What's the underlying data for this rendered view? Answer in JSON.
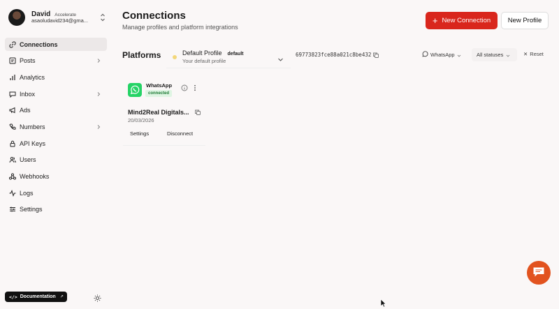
{
  "account": {
    "name": "David",
    "plan": "Accelerate",
    "email": "asaoludavid234@gma..."
  },
  "nav": {
    "items": [
      {
        "label": "Connections",
        "icon": "link-icon",
        "active": true
      },
      {
        "label": "Posts",
        "icon": "post-icon",
        "chevron": true
      },
      {
        "label": "Analytics",
        "icon": "bar-chart-icon"
      },
      {
        "label": "Inbox",
        "icon": "message-icon",
        "chevron": true
      },
      {
        "label": "Ads",
        "icon": "megaphone-icon"
      },
      {
        "label": "Numbers",
        "icon": "phone-icon",
        "chevron": true
      },
      {
        "label": "API Keys",
        "icon": "lock-icon"
      },
      {
        "label": "Users",
        "icon": "users-icon"
      },
      {
        "label": "Webhooks",
        "icon": "webhook-icon"
      },
      {
        "label": "Logs",
        "icon": "activity-icon"
      },
      {
        "label": "Settings",
        "icon": "sliders-icon"
      }
    ]
  },
  "footer": {
    "documentation_label": "Documentation"
  },
  "header": {
    "title": "Connections",
    "subtitle": "Manage profiles and platform integrations",
    "new_connection_label": "New Connection",
    "new_profile_label": "New Profile"
  },
  "platforms": {
    "title": "Platforms",
    "profile": {
      "name": "Default Profile",
      "tag": "default",
      "description": "Your default profile"
    },
    "profile_id": "69773823fce88a021c8be432",
    "filters": {
      "platform": "WhatsApp",
      "status": "All statuses",
      "reset_label": "Reset"
    }
  },
  "cards": [
    {
      "platform": "WhatsApp",
      "status": "connected",
      "account_name": "Mind2Real Digitals...",
      "date": "20/03/2026",
      "settings_label": "Settings",
      "disconnect_label": "Disconnect"
    }
  ],
  "colors": {
    "accent": "#d9261c",
    "whatsapp": "#25d366",
    "chat_fab": "#e2531f",
    "connected_bg": "#dff5e3",
    "connected_text": "#1e7a35"
  }
}
